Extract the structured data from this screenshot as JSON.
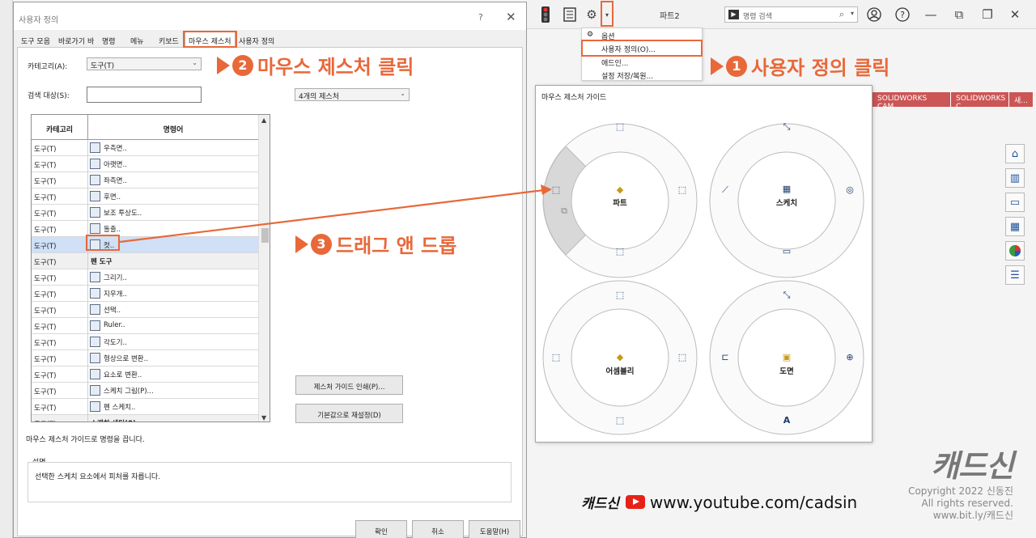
{
  "toolbar": {
    "doc_title": "파트2",
    "search_prefix": "▶",
    "search_placeholder": "명령 검색",
    "icons": [
      "traffic-light-icon",
      "options-list-icon",
      "gear-icon",
      "dropdown-arrow-icon",
      "user-icon",
      "help-icon",
      "minimize-icon",
      "restore-icon",
      "maximize-icon",
      "close-icon"
    ]
  },
  "options_menu": {
    "items": [
      "옵션",
      "사용자 정의(O)...",
      "애드인...",
      "설정 저장/복원..."
    ]
  },
  "right_tabs": [
    "SOLIDWORKS CAM",
    "SOLIDWORKS C...",
    "새..."
  ],
  "dialog": {
    "title": "사용자 정의",
    "help": "?",
    "close": "✕",
    "tabs": [
      "도구 모음",
      "바로가기 바",
      "명령",
      "메뉴",
      "키보드",
      "마우스 제스처",
      "사용자 정의"
    ],
    "category_label": "카테고리(A):",
    "category_value": "도구(T)",
    "search_label": "검색 대상(S):",
    "gesture_count_value": "4개의 제스처",
    "table": {
      "col_category": "카테고리",
      "col_command": "명령어",
      "rows": [
        {
          "cat": "도구(T)",
          "cmd": "우측면.."
        },
        {
          "cat": "도구(T)",
          "cmd": "아랫면.."
        },
        {
          "cat": "도구(T)",
          "cmd": "좌측면.."
        },
        {
          "cat": "도구(T)",
          "cmd": "후면.."
        },
        {
          "cat": "도구(T)",
          "cmd": "보조 투상도.."
        },
        {
          "cat": "도구(T)",
          "cmd": "돌출.."
        },
        {
          "cat": "도구(T)",
          "cmd": "컷.."
        },
        {
          "cat": "도구(T)",
          "cmd": "펜 도구"
        },
        {
          "cat": "도구(T)",
          "cmd": "그리기.."
        },
        {
          "cat": "도구(T)",
          "cmd": "지우개.."
        },
        {
          "cat": "도구(T)",
          "cmd": "선택.."
        },
        {
          "cat": "도구(T)",
          "cmd": "Ruler.."
        },
        {
          "cat": "도구(T)",
          "cmd": "각도기.."
        },
        {
          "cat": "도구(T)",
          "cmd": "형상으로 변환.."
        },
        {
          "cat": "도구(T)",
          "cmd": "요소로 변환.."
        },
        {
          "cat": "도구(T)",
          "cmd": "스케치 그림(P)..."
        },
        {
          "cat": "도구(T)",
          "cmd": "펜 스케치.."
        },
        {
          "cat": "도구(T)",
          "cmd": "스케치 세팅(S)"
        }
      ]
    },
    "print_button": "제스처 가이드 인쇄(P)...",
    "reset_button": "기본값으로 재설정(D)",
    "hint": "마우스 제스처 가이드로 명령을 끕니다.",
    "desc_label": "설명",
    "desc_text": "선택한 스케치 요소에서 피처를 자릅니다.",
    "ok_button": "확인",
    "cancel_button": "취소",
    "help_button": "도움말(H)"
  },
  "guide": {
    "title": "마우스 제스처 가이드",
    "rings": [
      {
        "name": "파트",
        "center_icon": "part-icon",
        "icons": [
          "top-view-icon",
          "left-view-icon",
          "right-view-icon",
          "bottom-view-icon",
          "cut-icon"
        ]
      },
      {
        "name": "스케치",
        "center_icon": "sketch-icon",
        "icons": [
          "smart-dimension-icon",
          "line-icon",
          "circle-icon",
          "rectangle-icon"
        ]
      },
      {
        "name": "어셈블리",
        "center_icon": "assembly-icon",
        "icons": [
          "top-view-icon",
          "left-view-icon",
          "right-view-icon",
          "bottom-view-icon"
        ]
      },
      {
        "name": "도면",
        "center_icon": "drawing-icon",
        "icons": [
          "smart-dimension-icon",
          "section-icon",
          "detail-icon",
          "note-icon"
        ]
      }
    ]
  },
  "annotations": {
    "step1": {
      "num": "1",
      "text": "사용자 정의 클릭"
    },
    "step2": {
      "num": "2",
      "text": "마우스 제스처 클릭"
    },
    "step3": {
      "num": "3",
      "text": "드래그 앤 드롭"
    },
    "accent_color": "#e8683a"
  },
  "branding": {
    "logo": "캐드신",
    "copyright": "Copyright 2022 신동진",
    "rights": "All rights reserved.",
    "site": "www.bit.ly/캐드신",
    "yt_brand": "캐드신",
    "yt_url": "www.youtube.com/cadsin"
  }
}
